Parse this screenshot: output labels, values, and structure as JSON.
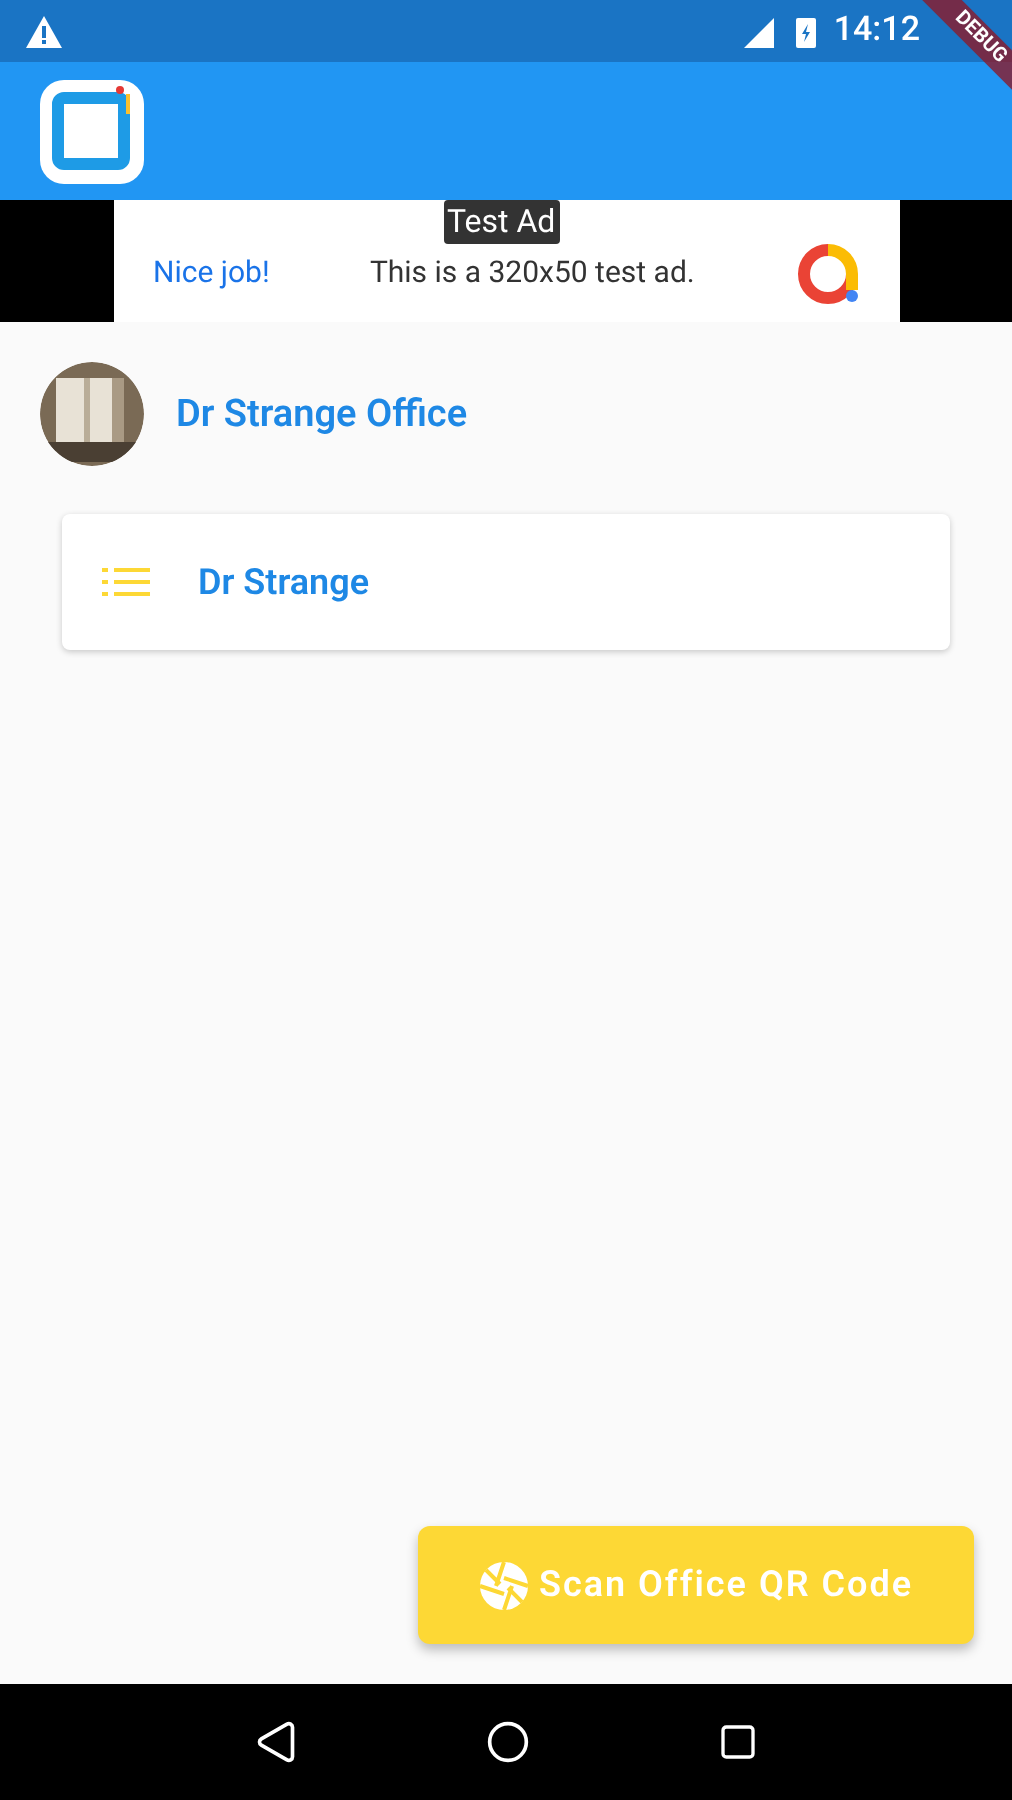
{
  "status_bar": {
    "time": "14:12"
  },
  "debug_banner": "DEBUG",
  "ad": {
    "badge": "Test Ad",
    "headline": "Nice job!",
    "text": "This is a 320x50 test ad."
  },
  "office": {
    "name": "Dr Strange Office"
  },
  "items": [
    {
      "label": "Dr Strange"
    }
  ],
  "scan_button": {
    "label": "Scan Office QR Code"
  }
}
